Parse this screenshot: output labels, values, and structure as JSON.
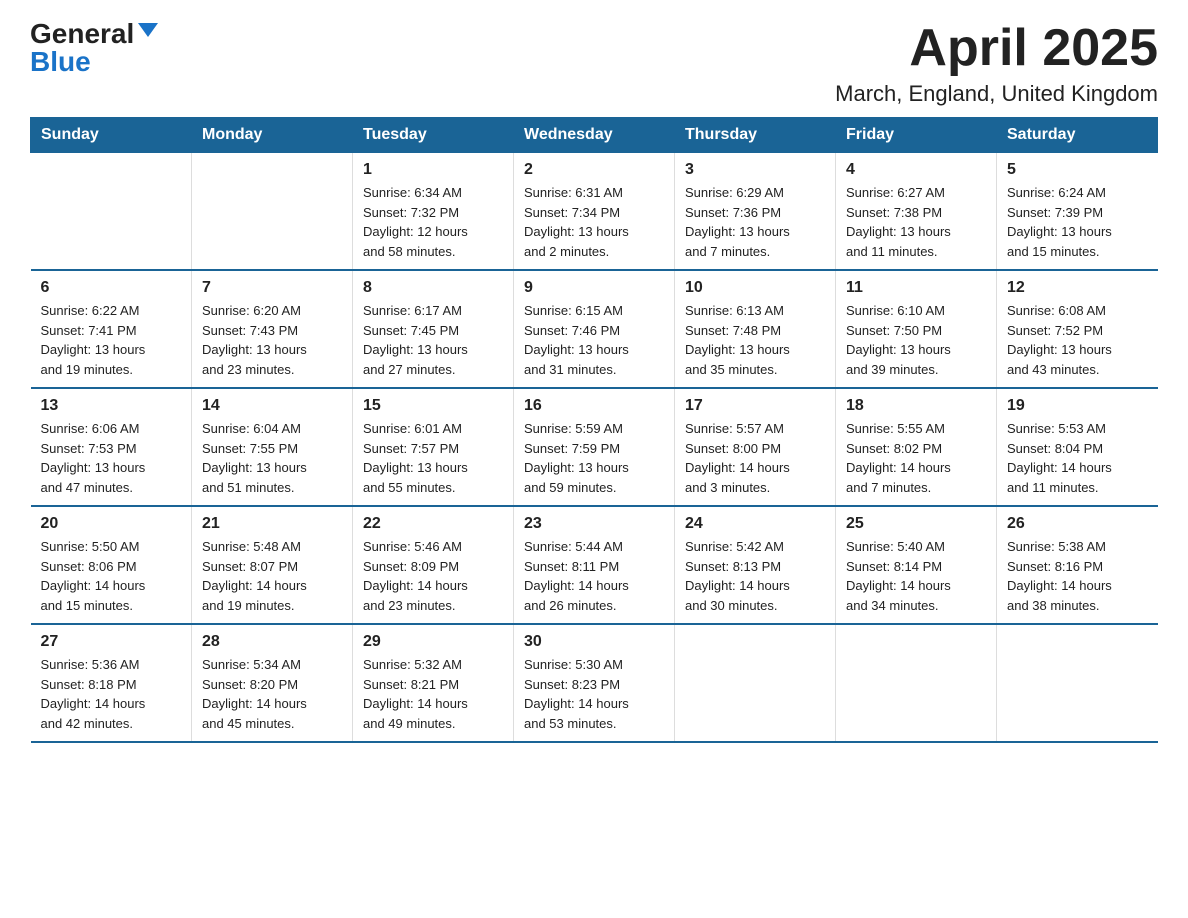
{
  "header": {
    "logo_general": "General",
    "logo_blue": "Blue",
    "month_title": "April 2025",
    "location": "March, England, United Kingdom"
  },
  "weekdays": [
    "Sunday",
    "Monday",
    "Tuesday",
    "Wednesday",
    "Thursday",
    "Friday",
    "Saturday"
  ],
  "weeks": [
    [
      {
        "day": "",
        "info": ""
      },
      {
        "day": "",
        "info": ""
      },
      {
        "day": "1",
        "info": "Sunrise: 6:34 AM\nSunset: 7:32 PM\nDaylight: 12 hours\nand 58 minutes."
      },
      {
        "day": "2",
        "info": "Sunrise: 6:31 AM\nSunset: 7:34 PM\nDaylight: 13 hours\nand 2 minutes."
      },
      {
        "day": "3",
        "info": "Sunrise: 6:29 AM\nSunset: 7:36 PM\nDaylight: 13 hours\nand 7 minutes."
      },
      {
        "day": "4",
        "info": "Sunrise: 6:27 AM\nSunset: 7:38 PM\nDaylight: 13 hours\nand 11 minutes."
      },
      {
        "day": "5",
        "info": "Sunrise: 6:24 AM\nSunset: 7:39 PM\nDaylight: 13 hours\nand 15 minutes."
      }
    ],
    [
      {
        "day": "6",
        "info": "Sunrise: 6:22 AM\nSunset: 7:41 PM\nDaylight: 13 hours\nand 19 minutes."
      },
      {
        "day": "7",
        "info": "Sunrise: 6:20 AM\nSunset: 7:43 PM\nDaylight: 13 hours\nand 23 minutes."
      },
      {
        "day": "8",
        "info": "Sunrise: 6:17 AM\nSunset: 7:45 PM\nDaylight: 13 hours\nand 27 minutes."
      },
      {
        "day": "9",
        "info": "Sunrise: 6:15 AM\nSunset: 7:46 PM\nDaylight: 13 hours\nand 31 minutes."
      },
      {
        "day": "10",
        "info": "Sunrise: 6:13 AM\nSunset: 7:48 PM\nDaylight: 13 hours\nand 35 minutes."
      },
      {
        "day": "11",
        "info": "Sunrise: 6:10 AM\nSunset: 7:50 PM\nDaylight: 13 hours\nand 39 minutes."
      },
      {
        "day": "12",
        "info": "Sunrise: 6:08 AM\nSunset: 7:52 PM\nDaylight: 13 hours\nand 43 minutes."
      }
    ],
    [
      {
        "day": "13",
        "info": "Sunrise: 6:06 AM\nSunset: 7:53 PM\nDaylight: 13 hours\nand 47 minutes."
      },
      {
        "day": "14",
        "info": "Sunrise: 6:04 AM\nSunset: 7:55 PM\nDaylight: 13 hours\nand 51 minutes."
      },
      {
        "day": "15",
        "info": "Sunrise: 6:01 AM\nSunset: 7:57 PM\nDaylight: 13 hours\nand 55 minutes."
      },
      {
        "day": "16",
        "info": "Sunrise: 5:59 AM\nSunset: 7:59 PM\nDaylight: 13 hours\nand 59 minutes."
      },
      {
        "day": "17",
        "info": "Sunrise: 5:57 AM\nSunset: 8:00 PM\nDaylight: 14 hours\nand 3 minutes."
      },
      {
        "day": "18",
        "info": "Sunrise: 5:55 AM\nSunset: 8:02 PM\nDaylight: 14 hours\nand 7 minutes."
      },
      {
        "day": "19",
        "info": "Sunrise: 5:53 AM\nSunset: 8:04 PM\nDaylight: 14 hours\nand 11 minutes."
      }
    ],
    [
      {
        "day": "20",
        "info": "Sunrise: 5:50 AM\nSunset: 8:06 PM\nDaylight: 14 hours\nand 15 minutes."
      },
      {
        "day": "21",
        "info": "Sunrise: 5:48 AM\nSunset: 8:07 PM\nDaylight: 14 hours\nand 19 minutes."
      },
      {
        "day": "22",
        "info": "Sunrise: 5:46 AM\nSunset: 8:09 PM\nDaylight: 14 hours\nand 23 minutes."
      },
      {
        "day": "23",
        "info": "Sunrise: 5:44 AM\nSunset: 8:11 PM\nDaylight: 14 hours\nand 26 minutes."
      },
      {
        "day": "24",
        "info": "Sunrise: 5:42 AM\nSunset: 8:13 PM\nDaylight: 14 hours\nand 30 minutes."
      },
      {
        "day": "25",
        "info": "Sunrise: 5:40 AM\nSunset: 8:14 PM\nDaylight: 14 hours\nand 34 minutes."
      },
      {
        "day": "26",
        "info": "Sunrise: 5:38 AM\nSunset: 8:16 PM\nDaylight: 14 hours\nand 38 minutes."
      }
    ],
    [
      {
        "day": "27",
        "info": "Sunrise: 5:36 AM\nSunset: 8:18 PM\nDaylight: 14 hours\nand 42 minutes."
      },
      {
        "day": "28",
        "info": "Sunrise: 5:34 AM\nSunset: 8:20 PM\nDaylight: 14 hours\nand 45 minutes."
      },
      {
        "day": "29",
        "info": "Sunrise: 5:32 AM\nSunset: 8:21 PM\nDaylight: 14 hours\nand 49 minutes."
      },
      {
        "day": "30",
        "info": "Sunrise: 5:30 AM\nSunset: 8:23 PM\nDaylight: 14 hours\nand 53 minutes."
      },
      {
        "day": "",
        "info": ""
      },
      {
        "day": "",
        "info": ""
      },
      {
        "day": "",
        "info": ""
      }
    ]
  ]
}
